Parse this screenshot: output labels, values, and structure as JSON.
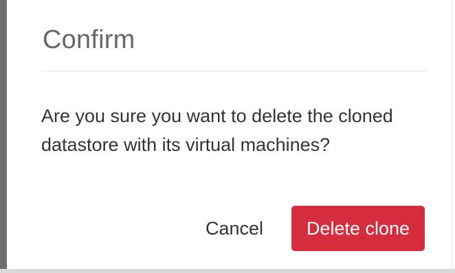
{
  "dialog": {
    "title": "Confirm",
    "message": "Are you sure you want to delete the cloned datastore with its virtual machines?",
    "cancel_label": "Cancel",
    "confirm_label": "Delete clone"
  },
  "colors": {
    "danger": "#d62d3e",
    "title_text": "#666666",
    "body_text": "#333333"
  }
}
